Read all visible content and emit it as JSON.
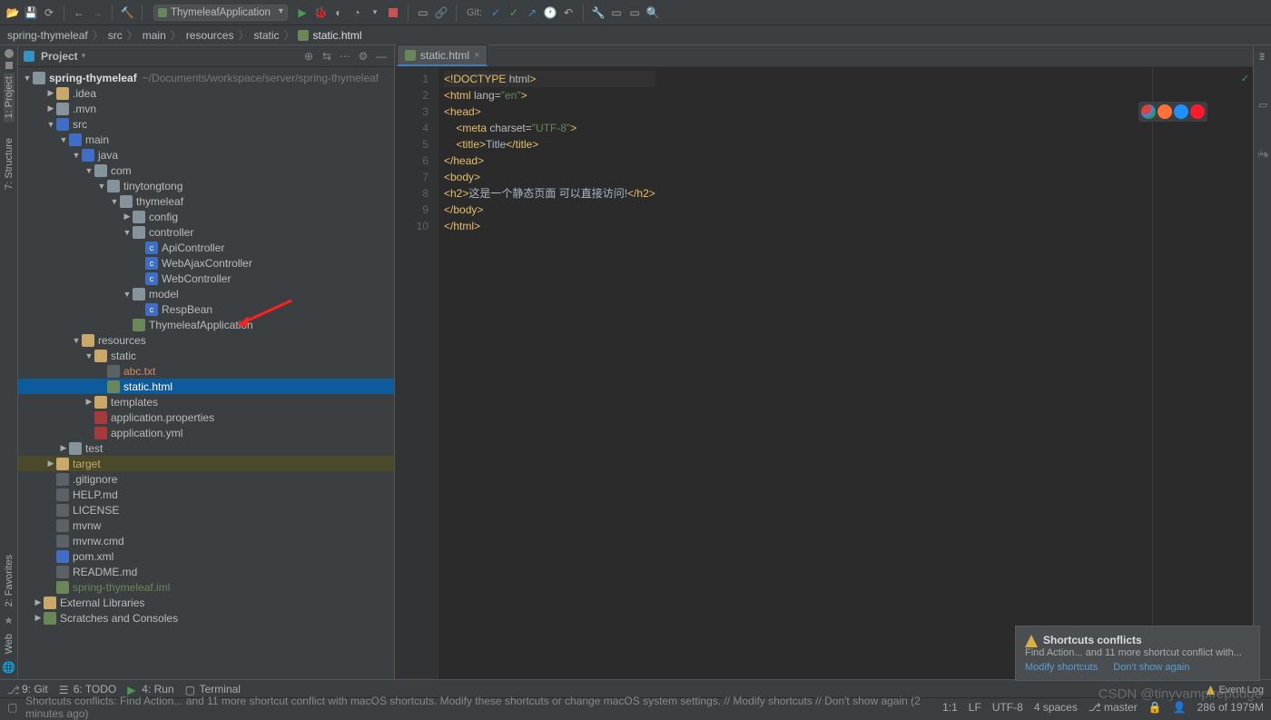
{
  "run_config": "ThymeleafApplication",
  "git_label": "Git:",
  "breadcrumb": [
    "spring-thymeleaf",
    "src",
    "main",
    "resources",
    "static",
    "static.html"
  ],
  "panel_title": "Project",
  "left_tools": {
    "project": "1: Project",
    "structure": "7: Structure",
    "favorites": "2: Favorites",
    "web": "Web"
  },
  "tree": {
    "root": "spring-thymeleaf",
    "root_path": "~/Documents/workspace/server/spring-thymeleaf",
    "idea": ".idea",
    "mvn": ".mvn",
    "src": "src",
    "main": "main",
    "java": "java",
    "com": "com",
    "tinytongtong": "tinytongtong",
    "thymeleaf": "thymeleaf",
    "config": "config",
    "controller": "controller",
    "api_controller": "ApiController",
    "web_ajax_controller": "WebAjaxController",
    "web_controller": "WebController",
    "model": "model",
    "resp_bean": "RespBean",
    "thymeleaf_app": "ThymeleafApplication",
    "resources": "resources",
    "static": "static",
    "abc_txt": "abc.txt",
    "static_html": "static.html",
    "templates": "templates",
    "app_prop": "application.properties",
    "app_yml": "application.yml",
    "test": "test",
    "target": "target",
    "gitignore": ".gitignore",
    "help_md": "HELP.md",
    "license": "LICENSE",
    "mvnw": "mvnw",
    "mvnw_cmd": "mvnw.cmd",
    "pom_xml": "pom.xml",
    "readme_md": "README.md",
    "iml": "spring-thymeleaf.iml",
    "ext_lib": "External Libraries",
    "scratches": "Scratches and Consoles"
  },
  "tab_name": "static.html",
  "code_lines": [
    {
      "n": 1,
      "html": "<span class='tag-s'>&lt;!DOCTYPE </span><span class='attr-n'>html</span><span class='tag-s'>&gt;</span>"
    },
    {
      "n": 2,
      "html": "<span class='tag-s'>&lt;html </span><span class='attr-n'>lang=</span><span class='attr-v'>\"en\"</span><span class='tag-s'>&gt;</span>"
    },
    {
      "n": 3,
      "html": "<span class='tag-s'>&lt;head&gt;</span>"
    },
    {
      "n": 4,
      "html": "    <span class='tag-s'>&lt;meta </span><span class='attr-n'>charset=</span><span class='attr-v'>\"UTF-8\"</span><span class='tag-s'>&gt;</span>"
    },
    {
      "n": 5,
      "html": "    <span class='tag-s'>&lt;title&gt;</span><span class='txt'>Title</span><span class='tag-s'>&lt;/title&gt;</span>"
    },
    {
      "n": 6,
      "html": "<span class='tag-s'>&lt;/head&gt;</span>"
    },
    {
      "n": 7,
      "html": "<span class='tag-s'>&lt;body&gt;</span>"
    },
    {
      "n": 8,
      "html": "<span class='tag-s'>&lt;h2&gt;</span><span class='txt'>这是一个静态页面 可以直接访问!</span><span class='tag-s'>&lt;/h2&gt;</span>"
    },
    {
      "n": 9,
      "html": "<span class='tag-s'>&lt;/body&gt;</span>"
    },
    {
      "n": 10,
      "html": "<span class='tag-s'>&lt;/html&gt;</span>"
    }
  ],
  "notif": {
    "title": "Shortcuts conflicts",
    "desc": "Find Action... and 11 more shortcut conflict with...",
    "link1": "Modify shortcuts",
    "link2": "Don't show again"
  },
  "bottom": {
    "git": "9: Git",
    "todo": "6: TODO",
    "run": "4: Run",
    "terminal": "Terminal",
    "event_log": "Event Log"
  },
  "status": {
    "msg": "Shortcuts conflicts: Find Action... and 11 more shortcut conflict with macOS shortcuts. Modify these shortcuts or change macOS system settings. // Modify shortcuts // Don't show again (2 minutes ago)",
    "pos": "1:1",
    "le": "LF",
    "enc": "UTF-8",
    "indent": "4 spaces",
    "branch": "master",
    "mem": "286 of 1979M"
  },
  "right_tool": {
    "m": "m",
    "database": "Database",
    "ant": "Ant"
  },
  "watermark": "CSDN @tinyvampirepudge"
}
